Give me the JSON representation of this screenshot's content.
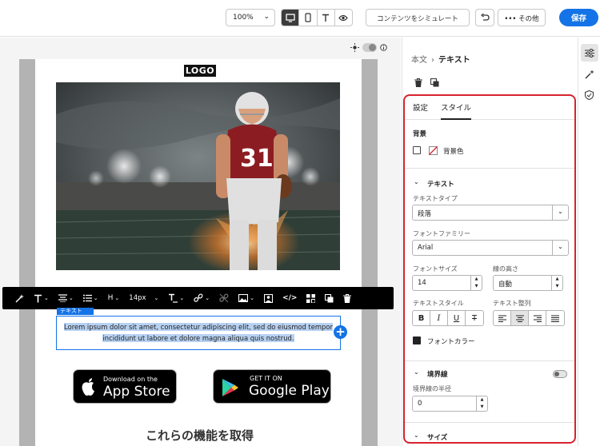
{
  "toolbar": {
    "zoom": "100%",
    "simulate_label": "コンテンツをシミュレート",
    "more_label": "••• その他",
    "save_label": "保存"
  },
  "canvas": {
    "logo_text": "LOGO",
    "text_tag": "テキスト",
    "body_text": "Lorem ipsum dolor sit amet, consectetur adipiscing elit, sed do eiusmod tempor incididunt ut labore et dolore magna aliqua quis nostrud.",
    "font_size_field": "14px",
    "app_store_small": "Download on the",
    "app_store_big": "App Store",
    "google_play_small": "GET IT ON",
    "google_play_big": "Google Play",
    "features_heading": "これらの機能を取得",
    "hero_jersey_number": "31"
  },
  "panel": {
    "breadcrumb_parent": "本文",
    "breadcrumb_sep": "›",
    "breadcrumb_current": "テキスト",
    "tab_settings": "設定",
    "tab_style": "スタイル",
    "background_title": "背景",
    "background_color_label": "背景色",
    "text_section_title": "テキスト",
    "text_type_label": "テキストタイプ",
    "text_type_value": "段落",
    "font_family_label": "フォントファミリー",
    "font_family_value": "Arial",
    "font_size_label": "フォントサイズ",
    "font_size_value": "14",
    "line_height_label": "線の高さ",
    "line_height_value": "自動",
    "text_style_label": "テキストスタイル",
    "text_align_label": "テキスト整列",
    "font_color_label": "フォントカラー",
    "border_title": "境界線",
    "border_radius_label": "境界線の半径",
    "border_radius_value": "0",
    "size_title": "サイズ"
  },
  "colors": {
    "accent": "#1473e6",
    "highlight_box": "#d7232e",
    "text_selection": "#b7d1f2"
  }
}
